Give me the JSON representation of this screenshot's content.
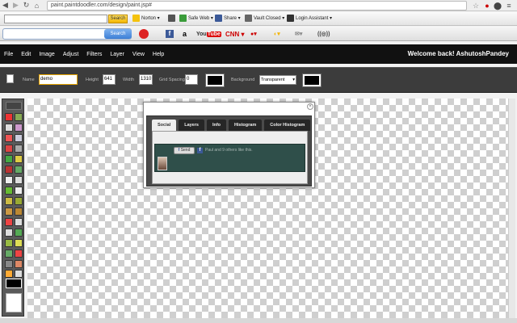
{
  "browser": {
    "url": "paint.paintdoodler.com/design/paint.jsp#"
  },
  "toolbar1": {
    "search_label": "Search",
    "items": [
      "Norton",
      "Safe Web",
      "Share",
      "Vault Closed",
      "Login Assistant"
    ]
  },
  "toolbar2": {
    "search_label": "Search",
    "icons": [
      "facebook-icon",
      "amazon-icon",
      "youtube-icon",
      "cnn-icon",
      "ebay-icon",
      "weather-icon",
      "mail-icon",
      "radio-icon"
    ]
  },
  "menu": {
    "items": [
      "File",
      "Edit",
      "Image",
      "Adjust",
      "Filters",
      "Layer",
      "View",
      "Help"
    ],
    "welcome": "Welcome back! AshutoshPandey"
  },
  "properties": {
    "name_label": "Name",
    "name_value": "demo",
    "height_label": "Height",
    "height_value": "641",
    "width_label": "Width",
    "width_value": "1310",
    "grid_label": "Grid Spacing",
    "grid_value": "0",
    "background_label": "Background",
    "background_value": "Transparent"
  },
  "dialog": {
    "tabs": [
      "Social",
      "Layers",
      "Info",
      "Histogram",
      "Color Histogram"
    ],
    "active_tab": "Social",
    "send_label": "Send",
    "fb_text": "Paul and 9 others like this."
  },
  "colors": {
    "menubar": "#111111",
    "propbar": "#3c3c3c",
    "social_panel": "#2f4f4a"
  }
}
